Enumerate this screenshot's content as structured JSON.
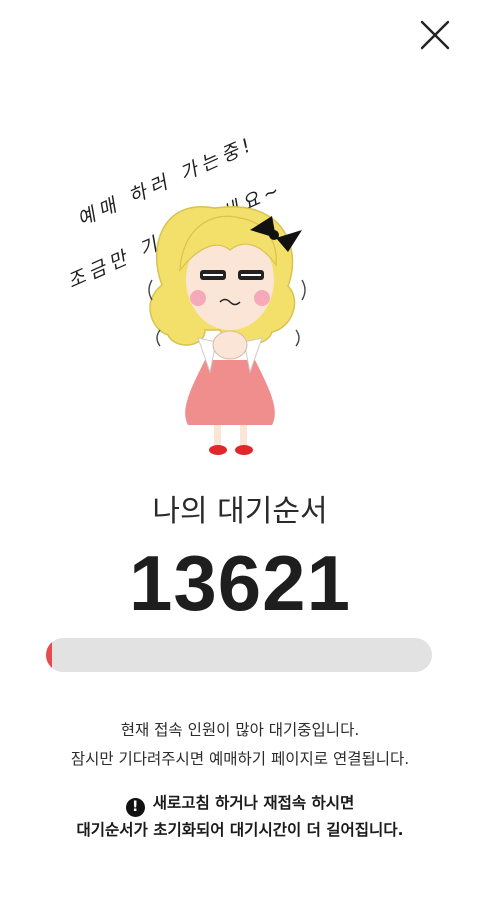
{
  "handwriting": {
    "line1": "예매 하러 가는중!",
    "line2": "조금만 기다려주세요~"
  },
  "queue": {
    "title": "나의 대기순서",
    "number": "13621",
    "progress": 0.015
  },
  "info": {
    "line1": "현재 접속 인원이 많아 대기중입니다.",
    "line2": "잠시만 기다려주시면 예매하기 페이지로 연결됩니다."
  },
  "warning": {
    "icon": "exclamation-circle-icon",
    "line1": "새로고침 하거나 재접속 하시면",
    "line2": "대기순서가 초기화되어 대기시간이 더 길어집니다."
  },
  "colors": {
    "accent": "#e54b4f",
    "track": "#e2e2e2",
    "hair": "#f3e06a",
    "dress": "#f08d8d"
  }
}
